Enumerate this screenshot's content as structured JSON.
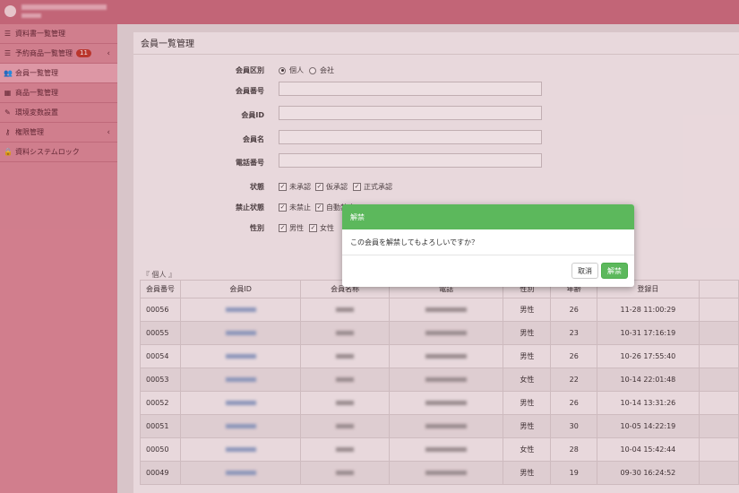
{
  "sidebar": {
    "items": [
      {
        "icon": "list-icon",
        "label": "資料書一覧管理"
      },
      {
        "icon": "list-icon",
        "label": "予約商品一覧管理",
        "badge": "11"
      },
      {
        "icon": "users-icon",
        "label": "会員一覧管理"
      },
      {
        "icon": "cubes-icon",
        "label": "商品一覧管理"
      },
      {
        "icon": "edit-icon",
        "label": "環境変数設置"
      },
      {
        "icon": "key-icon",
        "label": "権限管理"
      },
      {
        "icon": "lock-icon",
        "label": "資料システムロック"
      }
    ]
  },
  "panel": {
    "title": "会員一覧管理"
  },
  "form": {
    "member_type": {
      "label": "会員区別",
      "options": [
        "個人",
        "会社"
      ],
      "selected": "個人"
    },
    "member_no": {
      "label": "会員番号",
      "value": ""
    },
    "member_id": {
      "label": "会員ID",
      "value": ""
    },
    "member_name": {
      "label": "会員名",
      "value": ""
    },
    "phone": {
      "label": "電話番号",
      "value": ""
    },
    "status": {
      "label": "状態",
      "options": [
        "未承認",
        "仮承認",
        "正式承認"
      ]
    },
    "ban_status": {
      "label": "禁止状態",
      "options": [
        "未禁止",
        "自動禁止"
      ]
    },
    "gender": {
      "label": "性別",
      "options": [
        "男性",
        "女性"
      ]
    }
  },
  "table": {
    "caption": "『 個人 』",
    "columns": [
      "会員番号",
      "会員ID",
      "会員名称",
      "電話",
      "性別",
      "年齢",
      "登録日"
    ],
    "rows": [
      {
        "no": "00056",
        "gender": "男性",
        "age": "26",
        "date": "11-28 11:00:29"
      },
      {
        "no": "00055",
        "gender": "男性",
        "age": "23",
        "date": "10-31 17:16:19"
      },
      {
        "no": "00054",
        "gender": "男性",
        "age": "26",
        "date": "10-26 17:55:40"
      },
      {
        "no": "00053",
        "gender": "女性",
        "age": "22",
        "date": "10-14 22:01:48"
      },
      {
        "no": "00052",
        "gender": "男性",
        "age": "26",
        "date": "10-14 13:31:26"
      },
      {
        "no": "00051",
        "gender": "男性",
        "age": "30",
        "date": "10-05 14:22:19"
      },
      {
        "no": "00050",
        "gender": "女性",
        "age": "28",
        "date": "10-04 15:42:44"
      },
      {
        "no": "00049",
        "gender": "男性",
        "age": "19",
        "date": "09-30 16:24:52"
      }
    ]
  },
  "modal": {
    "title": "解禁",
    "message": "この会員を解禁してもよろしいですか？",
    "cancel_label": "取消",
    "confirm_label": "解禁"
  },
  "colors": {
    "sidebar": "#d98b99",
    "topbar": "#c96f80",
    "modal_header": "#5cb85c"
  }
}
